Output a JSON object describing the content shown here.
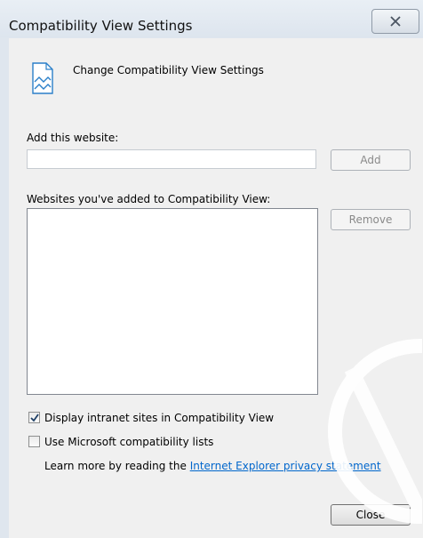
{
  "window": {
    "title": "Compatibility View Settings",
    "close_glyph": "☒"
  },
  "header": {
    "text": "Change Compatibility View Settings"
  },
  "add_site": {
    "label": "Add this website:",
    "value": "",
    "button_label": "Add"
  },
  "sites": {
    "label": "Websites you've added to Compatibility View:",
    "items": [],
    "remove_label": "Remove"
  },
  "options": {
    "intranet": {
      "label": "Display intranet sites in Compatibility View",
      "checked": true
    },
    "ms_lists": {
      "label": "Use Microsoft compatibility lists",
      "checked": false
    }
  },
  "learn_more": {
    "prefix": "Learn more by reading the ",
    "link": "Internet Explorer privacy statement"
  },
  "footer": {
    "close_label": "Close"
  },
  "colors": {
    "link": "#0066cc",
    "accent": "#2a7fc9"
  }
}
